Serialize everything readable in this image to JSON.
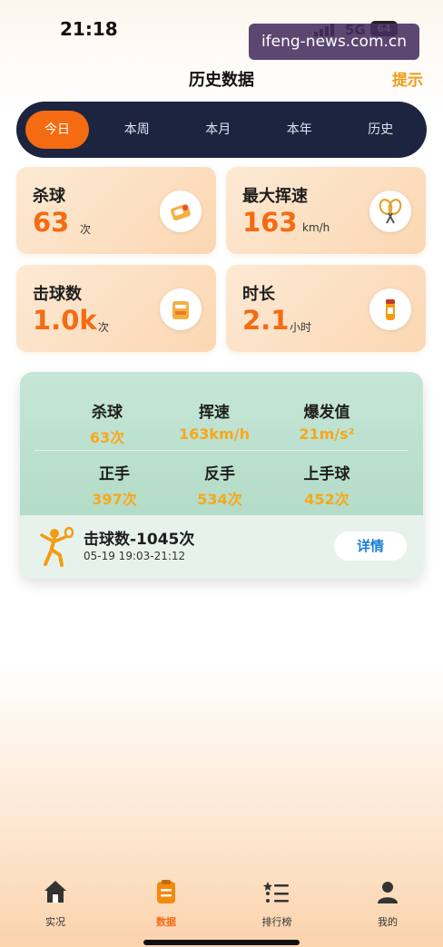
{
  "status_bar": {
    "time": "21:18",
    "network": "5G",
    "battery": "64"
  },
  "watermark": "ifeng-news.com.cn",
  "header": {
    "title": "历史数据",
    "hint_label": "提示",
    "accent_color": "#f29a17"
  },
  "period_tabs": [
    {
      "label": "今日",
      "active": true
    },
    {
      "label": "本周",
      "active": false
    },
    {
      "label": "本月",
      "active": false
    },
    {
      "label": "本年",
      "active": false
    },
    {
      "label": "历史",
      "active": false
    }
  ],
  "stats": {
    "smash": {
      "label": "杀球",
      "value": "63",
      "unit": "次",
      "icon": "shuttlecock-box-icon"
    },
    "max_speed": {
      "label": "最大挥速",
      "value": "163",
      "unit": "km/h",
      "icon": "racket-icon"
    },
    "hits": {
      "label": "击球数",
      "value": "1.0k",
      "unit": "次",
      "icon": "shuttlecock-box-icon"
    },
    "duration": {
      "label": "时长",
      "value": "2.1",
      "unit": "小时",
      "icon": "energy-drink-icon"
    }
  },
  "session": {
    "metrics_row1": [
      {
        "label": "杀球",
        "value": "63次"
      },
      {
        "label": "挥速",
        "value": "163km/h"
      },
      {
        "label": "爆发值",
        "value": "21m/s²"
      }
    ],
    "metrics_row2": [
      {
        "label": "正手",
        "value": "397次"
      },
      {
        "label": "反手",
        "value": "534次"
      },
      {
        "label": "上手球",
        "value": "452次"
      }
    ],
    "summary_title": "击球数-1045次",
    "summary_time": "05-19 19:03-21:12",
    "detail_label": "详情",
    "icon": "badminton-player-icon"
  },
  "nav": [
    {
      "label": "实况",
      "icon": "home-icon",
      "active": false
    },
    {
      "label": "数据",
      "icon": "clipboard-icon",
      "active": true
    },
    {
      "label": "排行榜",
      "icon": "ranking-list-icon",
      "active": false
    },
    {
      "label": "我的",
      "icon": "user-icon",
      "active": false
    }
  ],
  "colors": {
    "orange": "#f46b12",
    "yellow": "#f7a81a",
    "navy": "#1d2440",
    "blue": "#1a7fd6"
  }
}
